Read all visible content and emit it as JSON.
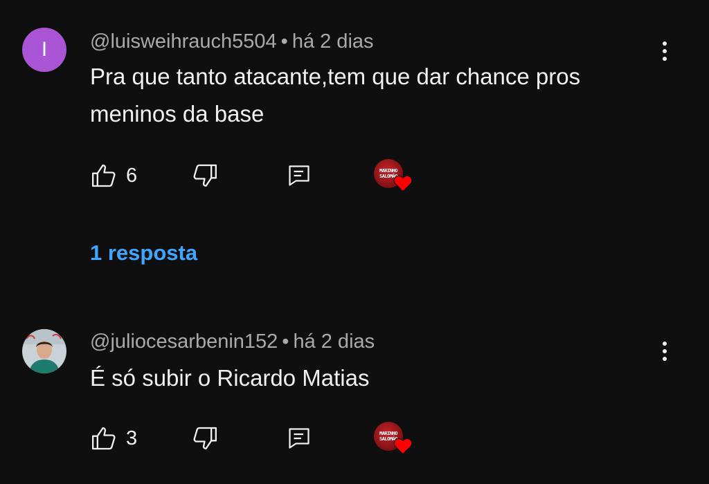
{
  "comments": [
    {
      "avatar_letter": "I",
      "avatar_color": "#a955d6",
      "username": "@luisweihrauch5504",
      "separator": "•",
      "time": "há 2 dias",
      "text": "Pra que tanto atacante,tem que dar chance pros meninos da base",
      "likes": "6",
      "creator_heart_badge": "MARINHO SALOMÃO"
    },
    {
      "avatar_icon": "user-photo",
      "username": "@juliocesarbenin152",
      "separator": "•",
      "time": "há 2 dias",
      "text": "É só subir o Ricardo Matias",
      "likes": "3",
      "creator_heart_badge": "MARINHO SALOMÃO"
    }
  ],
  "replies_link": "1 resposta",
  "colors": {
    "background": "#0f0f0f",
    "primary_text": "#f1f1f1",
    "secondary_text": "#aaaaaa",
    "link": "#3ea6ff",
    "heart": "#ff0000"
  }
}
